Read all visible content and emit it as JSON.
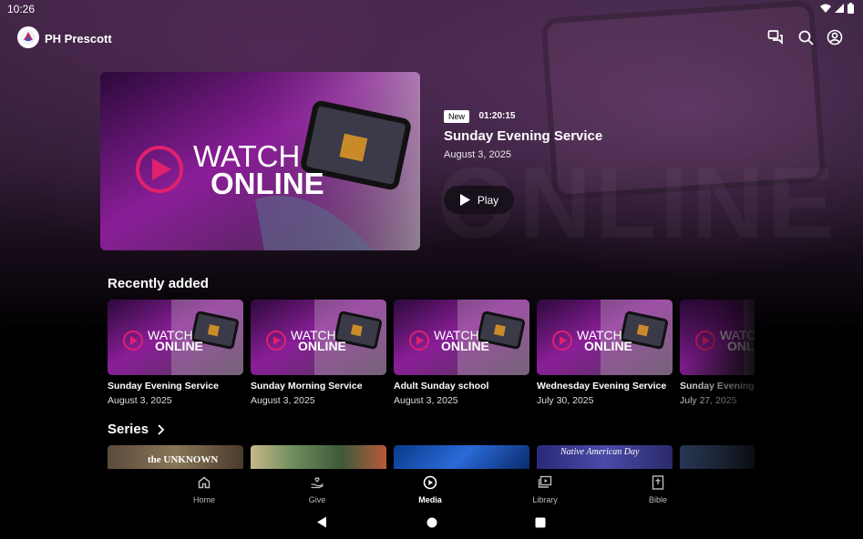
{
  "status": {
    "time": "10:26"
  },
  "app": {
    "title": "PH Prescott"
  },
  "hero": {
    "badge": "New",
    "duration": "01:20:15",
    "title": "Sunday Evening Service",
    "date": "August 3, 2025",
    "play_label": "Play",
    "thumb_line1": "WATCH",
    "thumb_line2": "ONLINE"
  },
  "recently_added": {
    "title": "Recently added",
    "items": [
      {
        "title": "Sunday Evening Service",
        "date": "August 3, 2025"
      },
      {
        "title": "Sunday Morning Service",
        "date": "August 3, 2025"
      },
      {
        "title": "Adult Sunday school",
        "date": "August 3, 2025"
      },
      {
        "title": "Wednesday Evening Service",
        "date": "July 30, 2025"
      },
      {
        "title": "Sunday Evening Service",
        "date": "July 27, 2025"
      }
    ]
  },
  "series": {
    "title": "Series",
    "thumb_texts": [
      "the UNKNOWN",
      "",
      "",
      "Native American Day",
      ""
    ]
  },
  "nav": {
    "items": [
      {
        "label": "Home"
      },
      {
        "label": "Give"
      },
      {
        "label": "Media"
      },
      {
        "label": "Library"
      },
      {
        "label": "Bible"
      }
    ],
    "active": "Media"
  },
  "colors": {
    "accent": "#d0208f",
    "thumb_purple": "#6a1d7a"
  }
}
